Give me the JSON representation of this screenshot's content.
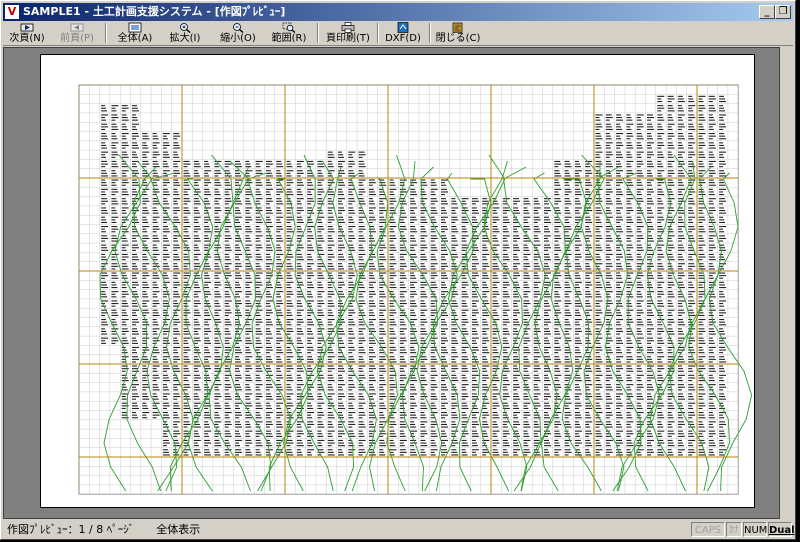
{
  "window": {
    "title": "SAMPLE1 - 土工計画支援システム - [作図ﾌﾟﾚﾋﾞｭｰ]",
    "app_icon_glyph": "V"
  },
  "titlebar_buttons": {
    "minimize": "_",
    "restore": "❐",
    "close": "✕"
  },
  "mdi_buttons": {
    "minimize": "_",
    "restore": "❐",
    "close": "✕"
  },
  "toolbar": {
    "next_page": "次頁(N)",
    "prev_page": "前頁(P)",
    "fit_all": "全体(A)",
    "zoom_in": "拡大(I)",
    "zoom_out": "縮小(O)",
    "range": "範囲(R)",
    "print_page": "頁印刷(T)",
    "dxf": "DXF(D)",
    "close": "閉じる(C)"
  },
  "status": {
    "text": "作図ﾌﾟﾚﾋﾞｭｰ：1 / 8 ﾍﾟｰｼﾞ　　全体表示",
    "caps": "CAPS",
    "kana": "ｶﾅ",
    "num": "NUM",
    "dual": "Dual"
  },
  "colors": {
    "titlebar_start": "#0a246a",
    "titlebar_end": "#a6caf0",
    "major_grid": "#b8860b",
    "minor_grid": "#c0c0c0",
    "contour": "#2e9e2e"
  }
}
